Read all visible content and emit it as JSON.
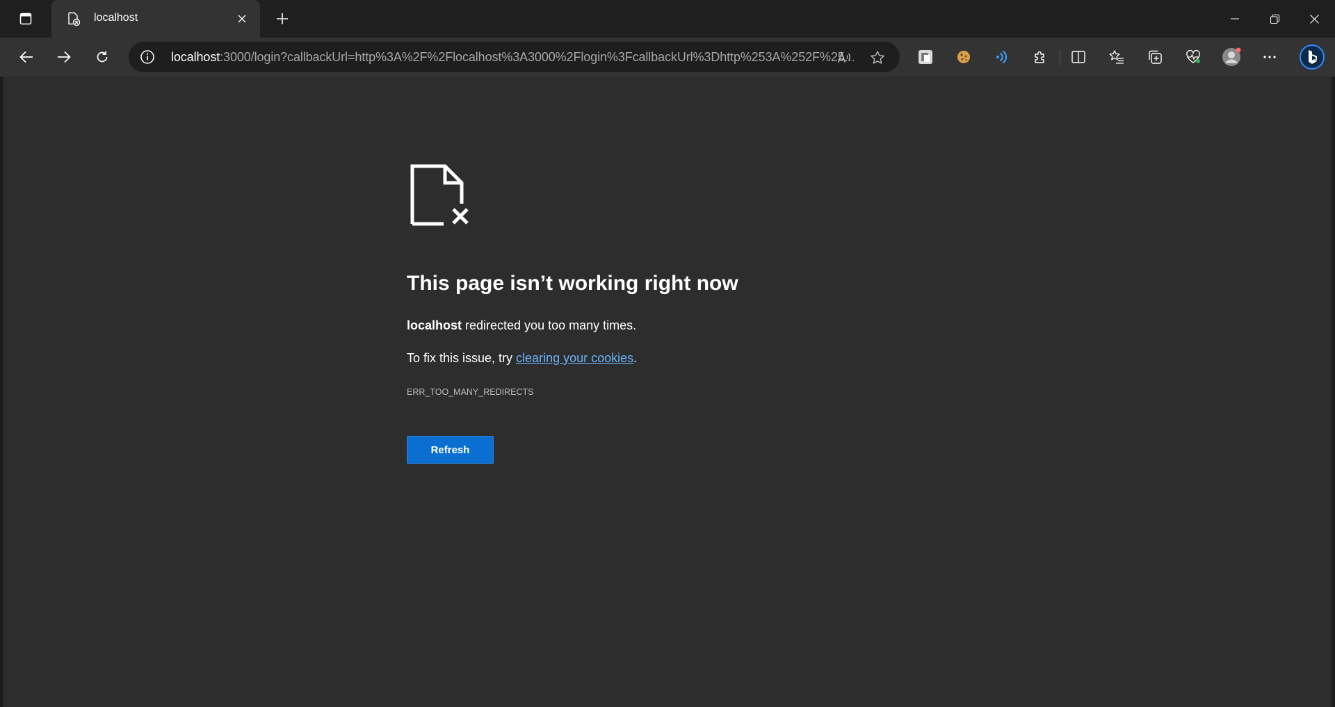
{
  "browser": {
    "tab": {
      "title": "localhost",
      "favicon": "error-page-icon"
    },
    "address": {
      "host": "localhost",
      "rest": ":3000/login?callbackUrl=http%3A%2F%2Flocalhost%3A3000%2Flogin%3FcallbackUrl%3Dhttp%253A%252F%25..."
    },
    "toolbar_icons": [
      "extension-1-icon",
      "cookie-icon",
      "wifi-icon",
      "puzzle-icon",
      "split-screen-icon",
      "favorites-icon",
      "collections-icon",
      "health-icon",
      "profile-icon",
      "more-icon",
      "bing-icon"
    ]
  },
  "error": {
    "title": "This page isn’t working right now",
    "host": "localhost",
    "message": " redirected you too many times.",
    "fix_prefix": "To fix this issue, try ",
    "fix_link": "clearing your cookies",
    "fix_suffix": ".",
    "code": "ERR_TOO_MANY_REDIRECTS",
    "refresh_label": "Refresh"
  },
  "colors": {
    "content_bg": "#2d2d2d",
    "toolbar_bg": "#333333",
    "accent": "#0a6fd1",
    "link": "#6cb4ff"
  }
}
